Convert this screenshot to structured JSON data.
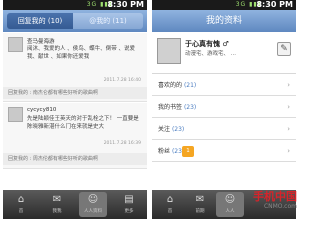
{
  "left_screen": {
    "status": {
      "time": "8:30 PM",
      "icons": "3G ▮▮▮"
    },
    "tabs": {
      "active": "回复我的 (10)",
      "inactive": "@我的 (11)"
    },
    "posts": [
      {
        "author": "查马曼海游",
        "text": "阅沐、我爱的人 、侯鸟、蝶牛、倒带 、说爱我、献世 、如果你还爱我",
        "time": "2011.7.28  16:40",
        "reply": "回复我的 : 南杰仑都有哪些好听的歌曲啊"
      },
      {
        "author": "cycycy810",
        "text": "先是陆颖佳王英天的对于乱栓之下！ 一直要是陈晓雅新湛什么门在来就是史大",
        "time": "2011.7.28  16:39",
        "reply": "回复我的 : 周杰伦都有哪些好听的歌曲啊"
      }
    ],
    "nav": [
      {
        "label": "首",
        "icon": "⌂"
      },
      {
        "label": "我我",
        "icon": "✉"
      },
      {
        "label": "人人资料",
        "icon": "☺"
      },
      {
        "label": "更多",
        "icon": "▤"
      }
    ]
  },
  "right_screen": {
    "status": {
      "time": "8:30 PM",
      "icons": "3G ▮▮▮"
    },
    "title": "我的资料",
    "profile": {
      "name": "于心真有愧 ♂",
      "bio": "动漫宅、游戏宅、 ..."
    },
    "menu": [
      {
        "label": "喜欢的的",
        "count": "(21)"
      },
      {
        "label": "我的书签",
        "count": "(23)"
      },
      {
        "label": "关注",
        "count": "(23)"
      },
      {
        "label": "粉丝",
        "count": "(23)",
        "badge": "1"
      }
    ],
    "nav": [
      {
        "label": "首",
        "icon": "⌂"
      },
      {
        "label": "前期",
        "icon": "✉"
      },
      {
        "label": "人人",
        "icon": "☺"
      }
    ]
  },
  "watermark": {
    "brand": "手机中国",
    "url": "CNMO.com"
  }
}
